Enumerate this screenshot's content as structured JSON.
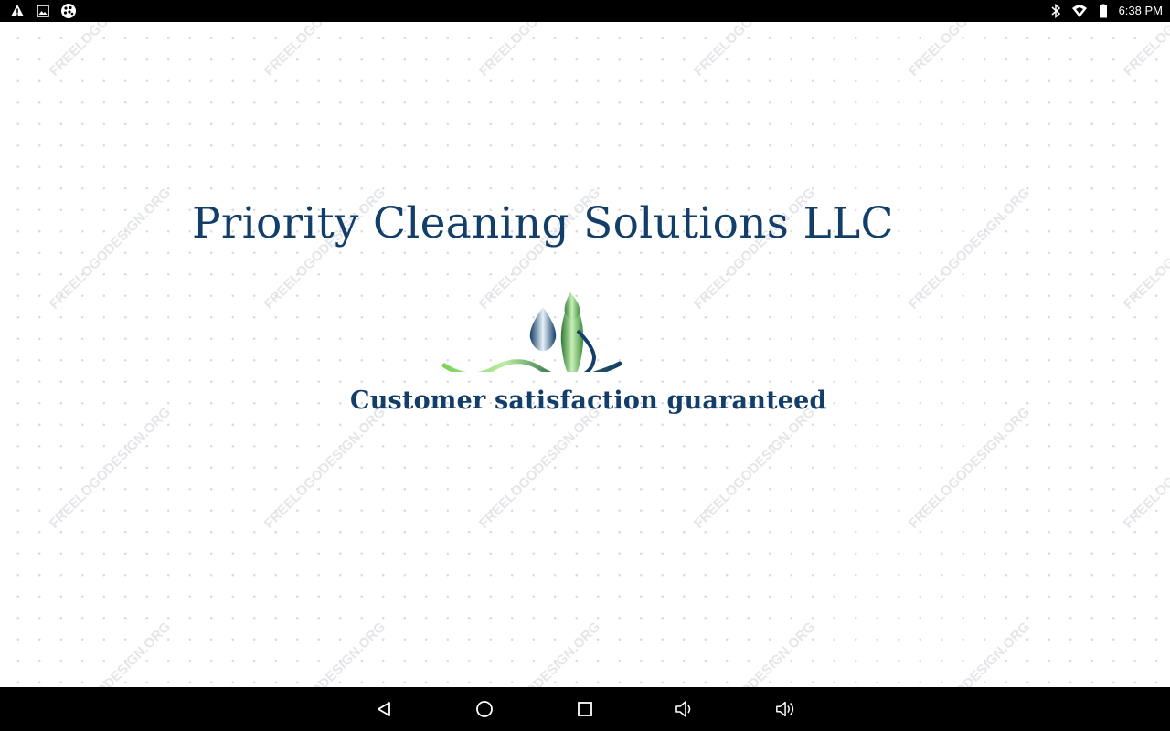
{
  "status_bar": {
    "left_icons": [
      "warning-icon",
      "gallery-icon",
      "notification-app-icon"
    ],
    "right_icons": [
      "bluetooth-icon",
      "wifi-icon",
      "battery-icon"
    ],
    "time": "6:38 PM"
  },
  "content": {
    "title": "Priority Cleaning Solutions LLC",
    "tagline": "Customer satisfaction guaranteed",
    "watermark": "FREELOGODESIGN.ORG",
    "colors": {
      "brand_blue": "#123e69",
      "accent_green": "#7bd35a"
    }
  },
  "nav_bar": {
    "buttons": [
      "back-icon",
      "home-icon",
      "recents-icon",
      "volume-down-icon",
      "volume-up-icon"
    ]
  }
}
